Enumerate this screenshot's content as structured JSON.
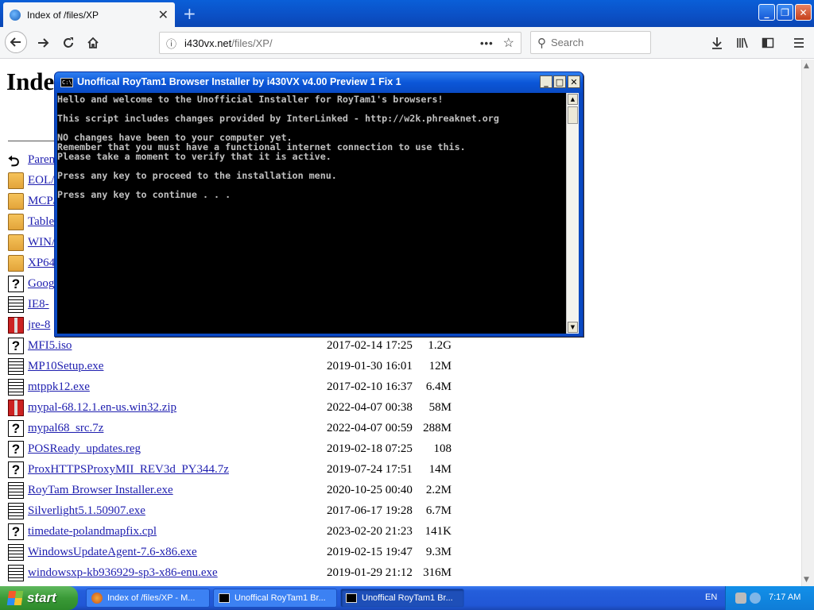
{
  "browser": {
    "tab_title": "Index of /files/XP",
    "tab_close": "✕",
    "new_tab": "+",
    "url_host": "i430vx.net",
    "url_path": "/files/XP/",
    "url_more": "•••",
    "search_placeholder": "Search",
    "window_buttons": {
      "minimize": "_",
      "maximize": "❐",
      "close": "✕"
    }
  },
  "page": {
    "title": "Index of /files/XP",
    "entries": [
      {
        "name": "Parent Directory",
        "date": "",
        "size": "",
        "icon": "back-icon"
      },
      {
        "name": "EOL/",
        "date": "",
        "size": "",
        "icon": "folder-icon"
      },
      {
        "name": "MCP/",
        "date": "",
        "size": "",
        "icon": "folder-icon"
      },
      {
        "name": "Tables/",
        "date": "",
        "size": "",
        "icon": "folder-icon"
      },
      {
        "name": "WIN/",
        "date": "",
        "size": "",
        "icon": "folder-icon"
      },
      {
        "name": "XP64/",
        "date": "",
        "size": "",
        "icon": "folder-icon"
      },
      {
        "name": "Goog",
        "date": "",
        "size": "",
        "icon": "unknown-file-icon"
      },
      {
        "name": "IE8-",
        "date": "",
        "size": "",
        "icon": "binary-file-icon"
      },
      {
        "name": "jre-8",
        "date": "",
        "size": "",
        "icon": "compressed-file-icon"
      },
      {
        "name": "MFI5.iso",
        "date": "2017-02-14 17:25",
        "size": "1.2G",
        "icon": "unknown-file-icon"
      },
      {
        "name": "MP10Setup.exe",
        "date": "2019-01-30 16:01",
        "size": "12M",
        "icon": "binary-file-icon"
      },
      {
        "name": "mtppk12.exe",
        "date": "2017-02-10 16:37",
        "size": "6.4M",
        "icon": "binary-file-icon"
      },
      {
        "name": "mypal-68.12.1.en-us.win32.zip",
        "date": "2022-04-07 00:38",
        "size": "58M",
        "icon": "compressed-file-icon"
      },
      {
        "name": "mypal68_src.7z",
        "date": "2022-04-07 00:59",
        "size": "288M",
        "icon": "unknown-file-icon"
      },
      {
        "name": "POSReady_updates.reg",
        "date": "2019-02-18 07:25",
        "size": "108",
        "icon": "unknown-file-icon"
      },
      {
        "name": "ProxHTTPSProxyMII_REV3d_PY344.7z",
        "date": "2019-07-24 17:51",
        "size": "14M",
        "icon": "unknown-file-icon"
      },
      {
        "name": "RoyTam Browser Installer.exe",
        "date": "2020-10-25 00:40",
        "size": "2.2M",
        "icon": "binary-file-icon"
      },
      {
        "name": "Silverlight5.1.50907.exe",
        "date": "2017-06-17 19:28",
        "size": "6.7M",
        "icon": "binary-file-icon"
      },
      {
        "name": "timedate-polandmapfix.cpl",
        "date": "2023-02-20 21:23",
        "size": "141K",
        "icon": "unknown-file-icon"
      },
      {
        "name": "WindowsUpdateAgent-7.6-x86.exe",
        "date": "2019-02-15 19:47",
        "size": "9.3M",
        "icon": "binary-file-icon"
      },
      {
        "name": "windowsxp-kb936929-sp3-x86-enu.exe",
        "date": "2019-01-29 21:12",
        "size": "316M",
        "icon": "binary-file-icon"
      }
    ]
  },
  "console": {
    "title": "Unoffical RoyTam1 Browser Installer by i430VX v4.00 Preview 1 Fix 1",
    "icon_text": "C:\\",
    "text": "Hello and welcome to the Unofficial Installer for RoyTam1's browsers!\n\nThis script includes changes provided by InterLinked - http://w2k.phreaknet.org\n\nNO changes have been to your computer yet.\nRemember that you must have a functional internet connection to use this.\nPlease take a moment to verify that it is active.\n\nPress any key to proceed to the installation menu.\n\nPress any key to continue . . .",
    "buttons": {
      "minimize": "_",
      "maximize": "□",
      "close": "✕"
    }
  },
  "taskbar": {
    "start_label": "start",
    "items": [
      {
        "label": "Index of /files/XP - M...",
        "icon": "firefox-icon"
      },
      {
        "label": "Unoffical RoyTam1 Br...",
        "icon": "console-icon"
      },
      {
        "label": "Unoffical RoyTam1 Br...",
        "icon": "console-icon"
      }
    ],
    "language": "EN",
    "clock": "7:17 AM"
  }
}
